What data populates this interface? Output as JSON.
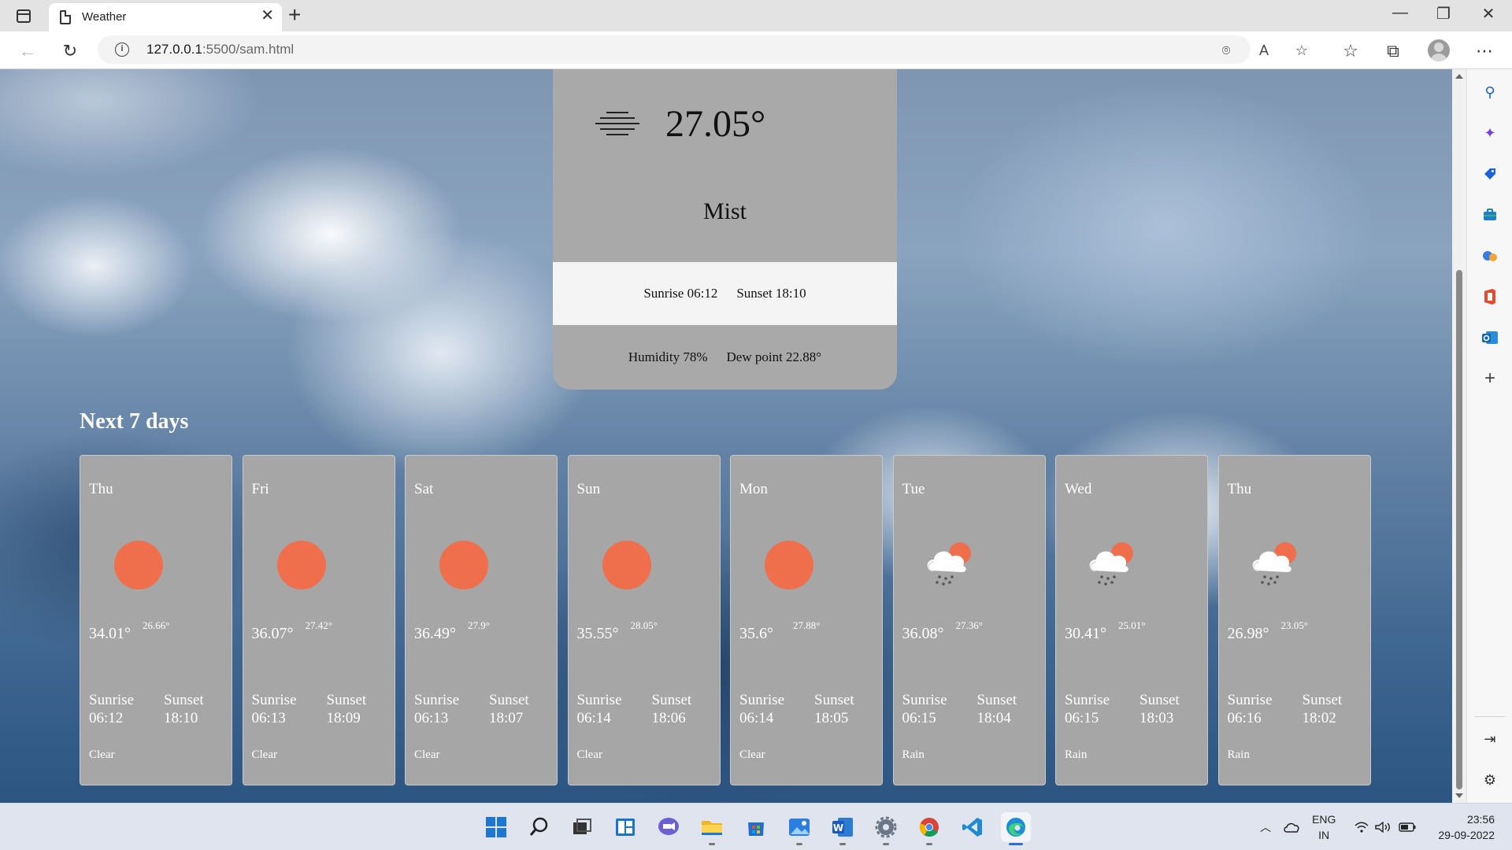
{
  "browser": {
    "tab_title": "Weather",
    "url_host": "127.0.0.1",
    "url_path": ":5500/sam.html"
  },
  "current": {
    "temp": "27.05°",
    "condition": "Mist",
    "sunrise": "Sunrise 06:12",
    "sunset": "Sunset 18:10",
    "humidity": "Humidity 78%",
    "dew_point": "Dew point 22.88°"
  },
  "forecast_title": "Next 7 days",
  "forecast": [
    {
      "day": "Thu",
      "icon": "sun-icon",
      "high": "34.01°",
      "low": "26.66°",
      "sunrise_label": "Sunrise",
      "sunrise": "06:12",
      "sunset_label": "Sunset",
      "sunset": "18:10",
      "condition": "Clear"
    },
    {
      "day": "Fri",
      "icon": "sun-icon",
      "high": "36.07°",
      "low": "27.42°",
      "sunrise_label": "Sunrise",
      "sunrise": "06:13",
      "sunset_label": "Sunset",
      "sunset": "18:09",
      "condition": "Clear"
    },
    {
      "day": "Sat",
      "icon": "sun-icon",
      "high": "36.49°",
      "low": "27.9°",
      "sunrise_label": "Sunrise",
      "sunrise": "06:13",
      "sunset_label": "Sunset",
      "sunset": "18:07",
      "condition": "Clear"
    },
    {
      "day": "Sun",
      "icon": "sun-icon",
      "high": "35.55°",
      "low": "28.05°",
      "sunrise_label": "Sunrise",
      "sunrise": "06:14",
      "sunset_label": "Sunset",
      "sunset": "18:06",
      "condition": "Clear"
    },
    {
      "day": "Mon",
      "icon": "sun-icon",
      "high": "35.6°",
      "low": "27.88°",
      "sunrise_label": "Sunrise",
      "sunrise": "06:14",
      "sunset_label": "Sunset",
      "sunset": "18:05",
      "condition": "Clear"
    },
    {
      "day": "Tue",
      "icon": "rain-cloud-icon",
      "high": "36.08°",
      "low": "27.36°",
      "sunrise_label": "Sunrise",
      "sunrise": "06:15",
      "sunset_label": "Sunset",
      "sunset": "18:04",
      "condition": "Rain"
    },
    {
      "day": "Wed",
      "icon": "rain-cloud-icon",
      "high": "30.41°",
      "low": "25.01°",
      "sunrise_label": "Sunrise",
      "sunrise": "06:15",
      "sunset_label": "Sunset",
      "sunset": "18:03",
      "condition": "Rain"
    },
    {
      "day": "Thu",
      "icon": "rain-cloud-icon",
      "high": "26.98°",
      "low": "23.05°",
      "sunrise_label": "Sunrise",
      "sunrise": "06:16",
      "sunset_label": "Sunset",
      "sunset": "18:02",
      "condition": "Rain"
    }
  ],
  "colors": {
    "card_gray": "#a9a9a9",
    "sun": "#ef6f4c",
    "band_white": "#f4f4f4"
  },
  "taskbar": {
    "apps": [
      "windows-start-icon",
      "search-icon",
      "task-view-icon",
      "widgets-icon",
      "teams-chat-icon",
      "file-explorer-icon",
      "microsoft-store-icon",
      "photos-icon",
      "word-icon",
      "settings-icon",
      "chrome-icon",
      "vscode-icon",
      "edge-icon"
    ],
    "lang_line1": "ENG",
    "lang_line2": "IN",
    "time": "23:56",
    "date": "29-09-2022"
  }
}
